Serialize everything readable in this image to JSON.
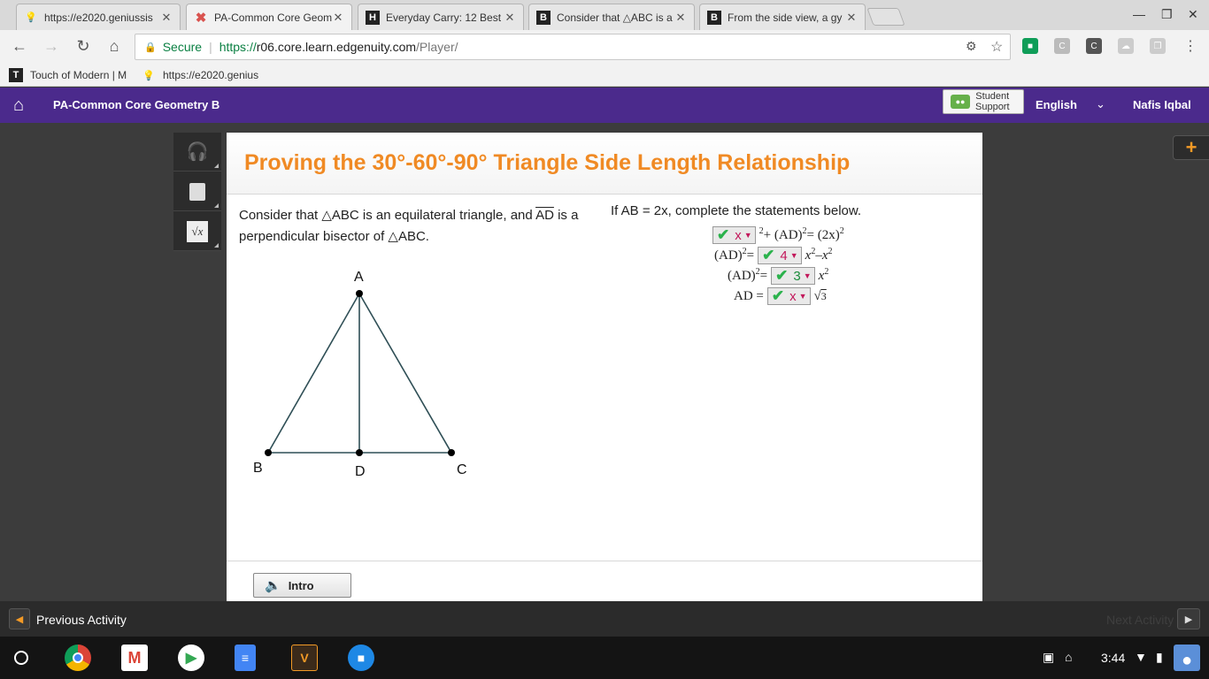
{
  "browser": {
    "tabs": [
      {
        "title": "https://e2020.geniussis",
        "favicon": "lightbulb-icon",
        "favicon_color": "#f4c20d"
      },
      {
        "title": "PA-Common Core Geom",
        "favicon": "edgenuity-x-icon",
        "favicon_color": "#d9534f"
      },
      {
        "title": "Everyday Carry: 12 Best",
        "favicon": "hiconsumption-icon",
        "favicon_color": "#222222"
      },
      {
        "title": "Consider that △ABC is a",
        "favicon": "brainly-icon",
        "favicon_color": "#222222"
      },
      {
        "title": "From the side view, a gy",
        "favicon": "brainly-icon",
        "favicon_color": "#222222"
      }
    ],
    "address": {
      "secure_label": "Secure",
      "separator": "|",
      "scheme": "https://",
      "host": "r06.core.learn.edgenuity.com",
      "path": "/Player/"
    },
    "bookmarks": [
      {
        "label": "Touch of Modern | M",
        "icon": "touch-of-modern-icon"
      },
      {
        "label": "https://e2020.genius",
        "icon": "lightbulb-icon"
      }
    ]
  },
  "course": {
    "title": "PA-Common Core Geometry B",
    "support_line1": "Student",
    "support_line2": "Support",
    "language": "English",
    "user": "Nafis Iqbal"
  },
  "lesson": {
    "title": "Proving the 30°-60°-90° Triangle Side Length Relationship",
    "prompt_part1": "Consider that △ABC is an equilateral triangle, and ",
    "prompt_segment": "AD",
    "prompt_part2": " is a perpendicular bisector of △ABC.",
    "instructions": "If AB = 2x, complete the statements below.",
    "diagram_labels": {
      "A": "A",
      "B": "B",
      "C": "C",
      "D": "D"
    },
    "equations": {
      "eq1": {
        "dropdown": "x",
        "mid": " + (AD)",
        "rhs": " = (2x)"
      },
      "eq2": {
        "lhs": "(AD)",
        "eqsign": " = ",
        "dropdown": "4",
        "rhs_a": "x",
        "rhs_b": " – ",
        "rhs_c": "x"
      },
      "eq3": {
        "lhs": "(AD)",
        "eqsign": " = ",
        "dropdown": "3",
        "rhs": "x"
      },
      "eq4": {
        "lhs": "AD = ",
        "dropdown": "x",
        "radicand": "3"
      },
      "exponent": "2"
    },
    "intro_label": "Intro"
  },
  "activity_nav": {
    "previous": "Previous Activity",
    "next": "Next Activity"
  },
  "shelf": {
    "time": "3:44"
  },
  "colors": {
    "brand_purple": "#4b2a8c",
    "title_orange": "#f08a24",
    "check_green": "#2bb24c",
    "answer_magenta": "#c2185b"
  }
}
